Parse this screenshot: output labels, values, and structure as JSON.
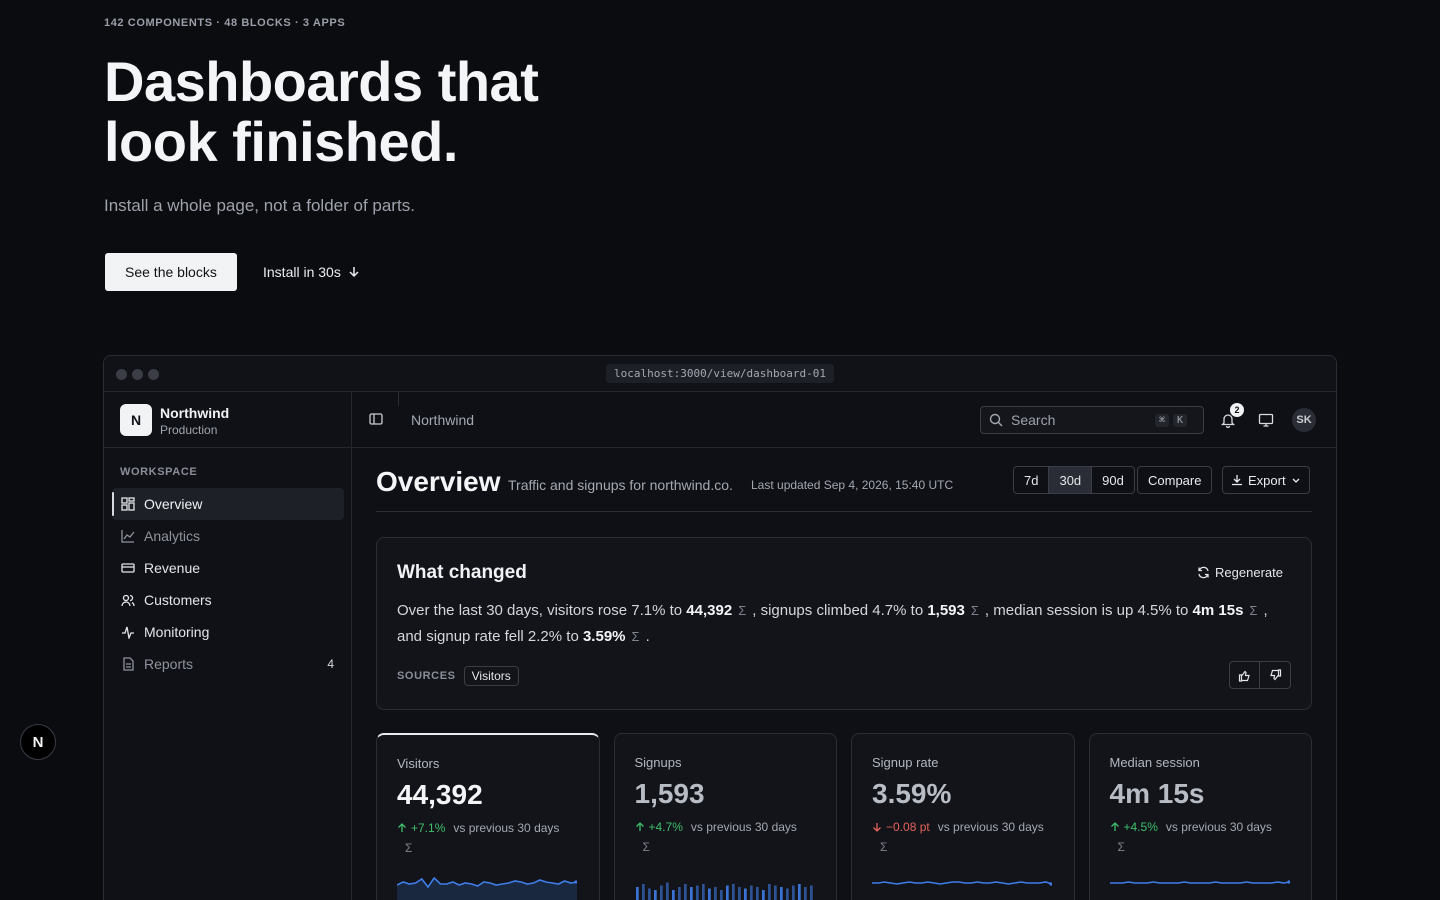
{
  "hero": {
    "eyebrow": "142 COMPONENTS · 48 BLOCKS · 3 APPS",
    "headline": "Dashboards that look finished.",
    "subhead": "Install a whole page, not a folder of parts.",
    "cta_primary": "See the blocks",
    "cta_secondary": "Install in 30s"
  },
  "window": {
    "url": "localhost:3000/view/dashboard-01"
  },
  "sidebar": {
    "org_initial": "N",
    "org_name": "Northwind",
    "org_env": "Production",
    "section_label": "WORKSPACE",
    "items": [
      {
        "label": "Overview",
        "icon": "grid-icon"
      },
      {
        "label": "Analytics",
        "icon": "line-chart-icon"
      },
      {
        "label": "Revenue",
        "icon": "card-icon"
      },
      {
        "label": "Customers",
        "icon": "users-icon"
      },
      {
        "label": "Monitoring",
        "icon": "pulse-icon"
      },
      {
        "label": "Reports",
        "icon": "document-icon",
        "count": "4"
      }
    ]
  },
  "topbar": {
    "breadcrumb": "Northwind",
    "search_placeholder": "Search",
    "shortcut_1": "⌘",
    "shortcut_2": "K",
    "notifications": "2",
    "user_initials": "SK"
  },
  "page": {
    "title": "Overview",
    "description": "Traffic and signups for northwind.co.",
    "updated": "Last updated Sep 4, 2026, 15:40 UTC",
    "ranges": [
      "7d",
      "30d",
      "90d"
    ],
    "selected_range": "30d",
    "compare_label": "Compare",
    "export_label": "Export"
  },
  "summary": {
    "title": "What changed",
    "regenerate_label": "Regenerate",
    "p1": "Over the last 30 days, visitors rose 7.1% to ",
    "v1": "44,392",
    "p2": ", signups climbed 4.7% to ",
    "v2": "1,593",
    "p3": ", median session is up 4.5% to ",
    "v3": "4m 15s",
    "p4": ", and signup rate fell 2.2% to ",
    "v4": "3.59%",
    "p5": ".",
    "sigma": "Σ",
    "sources_label": "SOURCES",
    "source": "Visitors"
  },
  "kpis": [
    {
      "label": "Visitors",
      "value": "44,392",
      "delta": "+7.1%",
      "direction": "up",
      "vs": "vs previous 30 days",
      "spark": "line",
      "points": [
        8,
        11,
        9,
        10,
        14,
        6,
        15,
        9,
        9,
        11,
        8,
        10,
        9,
        7,
        11,
        10,
        8,
        9,
        10,
        12,
        11,
        9,
        10,
        13,
        11,
        10,
        9,
        12,
        10,
        11
      ]
    },
    {
      "label": "Signups",
      "value": "1,593",
      "delta": "+4.7%",
      "direction": "up",
      "vs": "vs previous 30 days",
      "spark": "bar",
      "points": [
        6,
        8,
        5,
        4,
        7,
        9,
        4,
        6,
        8,
        6,
        7,
        8,
        5,
        6,
        4,
        7,
        8,
        6,
        5,
        7,
        6,
        4,
        8,
        7,
        6,
        5,
        7,
        8,
        6,
        7
      ]
    },
    {
      "label": "Signup rate",
      "value": "3.59%",
      "delta": "−0.08 pt",
      "direction": "down",
      "vs": "vs previous 30 days",
      "spark": "line",
      "points": [
        9,
        9,
        10,
        9,
        8,
        9,
        10,
        9,
        9,
        10,
        9,
        8,
        9,
        10,
        10,
        9,
        9,
        10,
        9,
        9,
        10,
        9,
        8,
        9,
        10,
        9,
        9,
        9,
        10,
        8
      ]
    },
    {
      "label": "Median session",
      "value": "4m 15s",
      "delta": "+4.5%",
      "direction": "up",
      "vs": "vs previous 30 days",
      "spark": "line",
      "points": [
        9,
        9,
        9,
        10,
        9,
        9,
        9,
        10,
        9,
        9,
        9,
        9,
        10,
        9,
        9,
        9,
        9,
        10,
        9,
        9,
        9,
        9,
        10,
        9,
        9,
        9,
        9,
        10,
        9,
        10
      ]
    }
  ],
  "colors": {
    "accent_up": "#3fbf6a",
    "accent_down": "#e5635c",
    "spark": "#3f7de8"
  },
  "floating_badge": "N"
}
